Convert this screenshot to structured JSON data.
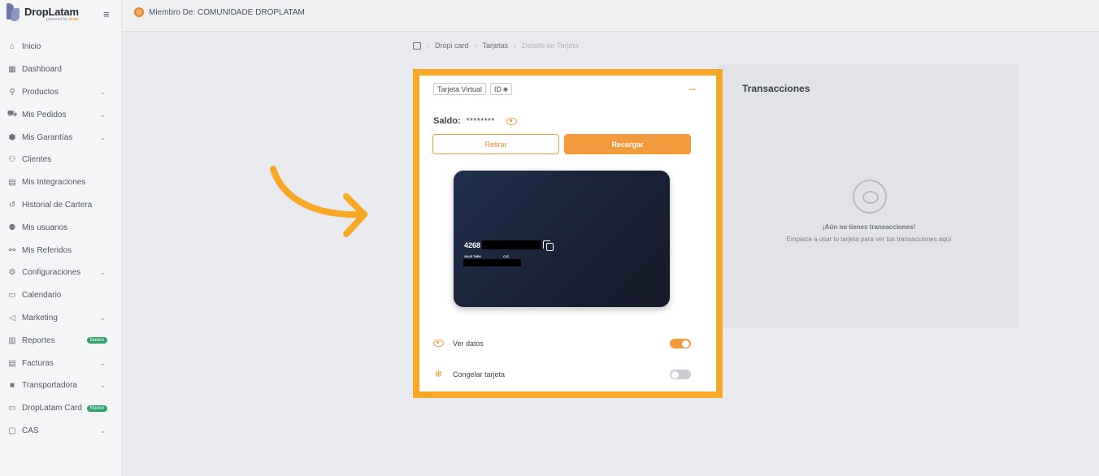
{
  "app": {
    "name": "DropLatam",
    "sub_prefix": "powered by",
    "sub_brand": "dropi",
    "menu_icon": "hamburger-icon"
  },
  "header": {
    "member_label": "Miembro De: COMUNIDADE DROPLATAM"
  },
  "sidebar": {
    "items": [
      {
        "label": "Inicio",
        "icon": "home-icon",
        "chevron": ""
      },
      {
        "label": "Dashboard",
        "icon": "dashboard-icon",
        "chevron": ""
      },
      {
        "label": "Productos",
        "icon": "search-icon",
        "chevron": "⌄"
      },
      {
        "label": "Mis Pedidos",
        "icon": "cart-icon",
        "chevron": "⌄"
      },
      {
        "label": "Mis Garantías",
        "icon": "shield-icon",
        "chevron": "⌄"
      },
      {
        "label": "Clientes",
        "icon": "users-icon",
        "chevron": ""
      },
      {
        "label": "Mis Integraciones",
        "icon": "store-icon",
        "chevron": ""
      },
      {
        "label": "Historial de Cartera",
        "icon": "history-icon",
        "chevron": ""
      },
      {
        "label": "Mis usuarios",
        "icon": "group-icon",
        "chevron": ""
      },
      {
        "label": "Mis Referidos",
        "icon": "referral-icon",
        "chevron": ""
      },
      {
        "label": "Configuraciones",
        "icon": "gear-icon",
        "chevron": "⌄"
      },
      {
        "label": "Calendario",
        "icon": "calendar-icon",
        "chevron": ""
      },
      {
        "label": "Marketing",
        "icon": "megaphone-icon",
        "chevron": "⌄"
      },
      {
        "label": "Reportes",
        "icon": "chart-icon",
        "chevron": "⌄",
        "badge": "Nuevo"
      },
      {
        "label": "Facturas",
        "icon": "invoice-icon",
        "chevron": "⌄"
      },
      {
        "label": "Transportadora",
        "icon": "truck-icon",
        "chevron": "⌄"
      },
      {
        "label": "DropLatam Card",
        "icon": "card-icon",
        "chevron": "",
        "badge": "Nuevo"
      },
      {
        "label": "CAS",
        "icon": "chat-icon",
        "chevron": "⌄"
      }
    ]
  },
  "breadcrumb": {
    "items": [
      "Dropi card",
      "Tarjetas",
      "Detalle de Tarjeta"
    ]
  },
  "card_detail": {
    "tag_type": "Tarjeta Virtual",
    "tag_id": "ID",
    "more_label": "···",
    "balance_label": "Saldo:",
    "balance_value": "********",
    "withdraw_label": "Retirar",
    "recharge_label": "Recargar",
    "card_number_prefix": "4268 3",
    "valid_thru_label": "VALID THRU",
    "cvc_label": "CVC",
    "view_data_label": "Ver datos",
    "view_data_on": true,
    "freeze_label": "Congelar tarjeta",
    "freeze_on": false
  },
  "transactions": {
    "title": "Transacciones",
    "empty_title": "¡Aún no tienes transacciones!",
    "empty_subtitle": "Empieza a usar tu tarjeta para ver tus transacciones aquí"
  },
  "colors": {
    "accent": "#f39a3c",
    "highlight_frame": "#f7a825",
    "card_bg": "#1a2236",
    "badge_green": "#2ea36b"
  }
}
